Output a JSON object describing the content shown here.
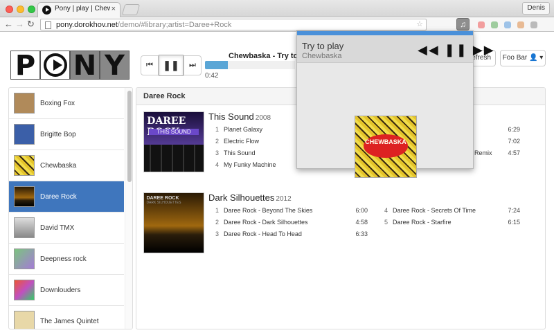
{
  "browser": {
    "tab_title": "Pony | play | Chewbaska",
    "tab_close": "×",
    "profile": "Denis",
    "url_host": "pony.dorokhov.net",
    "url_path": "/demo/#library;artist=Daree+Rock",
    "back": "←",
    "forward": "→",
    "reload": "↻"
  },
  "app": {
    "logo_letters": [
      "P",
      "N",
      "Y"
    ],
    "now_playing_title": "Chewbaska - Try to play",
    "progress": 0.25,
    "elapsed": "0:42",
    "prev_icon": "⏮",
    "pause_icon": "❚❚",
    "next_icon": "⏭",
    "refresh_label": "Refresh ↻",
    "user_label": "Foo Bar 👤 ▾"
  },
  "sidebar": {
    "artists": [
      {
        "name": "Boxing Fox",
        "color": "#b08a5a"
      },
      {
        "name": "Brigitte Bop",
        "color": "#3b5fa8"
      },
      {
        "name": "Chewbaska",
        "color": "#e0b22a"
      },
      {
        "name": "Daree Rock",
        "color": "#2a2010",
        "active": true
      },
      {
        "name": "David TMX",
        "color": "#bbbbbb"
      },
      {
        "name": "Deepness rock",
        "color": "#7bc47f"
      },
      {
        "name": "Downlouders",
        "color": "#c050c0"
      },
      {
        "name": "The James Quintet",
        "color": "#e8d8a8"
      }
    ]
  },
  "main": {
    "header": "Daree Rock",
    "albums": [
      {
        "title": "This Sound",
        "year": "2008",
        "cover_text_1": "DAREE ROCK",
        "cover_text_2": "THIS SOUND",
        "tracks_left": [
          {
            "no": "1",
            "name": "Planet Galaxy",
            "dur": "6:29"
          },
          {
            "no": "2",
            "name": "Electric Flow",
            "dur": "7:02"
          },
          {
            "no": "3",
            "name": "This Sound",
            "dur": "4:57"
          },
          {
            "no": "4",
            "name": "My Funky Machine",
            "dur": ""
          }
        ],
        "visible_fragment": "Remix"
      },
      {
        "title": "Dark Silhouettes",
        "year": "2012",
        "cover_text_1": "DAREE ROCK",
        "cover_text_2": "DARK SILHOUETTES",
        "tracks_left": [
          {
            "no": "1",
            "name": "Daree Rock - Beyond The Skies",
            "dur": "6:00"
          },
          {
            "no": "2",
            "name": "Daree Rock - Dark Silhouettes",
            "dur": "4:58"
          },
          {
            "no": "3",
            "name": "Daree Rock - Head To Head",
            "dur": "6:33"
          }
        ],
        "tracks_right": [
          {
            "no": "4",
            "name": "Daree Rock - Secrets Of Time",
            "dur": "7:24"
          },
          {
            "no": "5",
            "name": "Daree Rock - Starfire",
            "dur": "6:15"
          }
        ]
      }
    ]
  },
  "popup": {
    "title": "Try to play",
    "artist": "Chewbaska",
    "controls": "◀◀ ❚❚ ▶▶",
    "cover_text": "CHEWBASKA"
  },
  "colors": {
    "accent": "#3f76bd",
    "progress": "#5aa6d6",
    "popup_stripe": "#4a90d9"
  }
}
